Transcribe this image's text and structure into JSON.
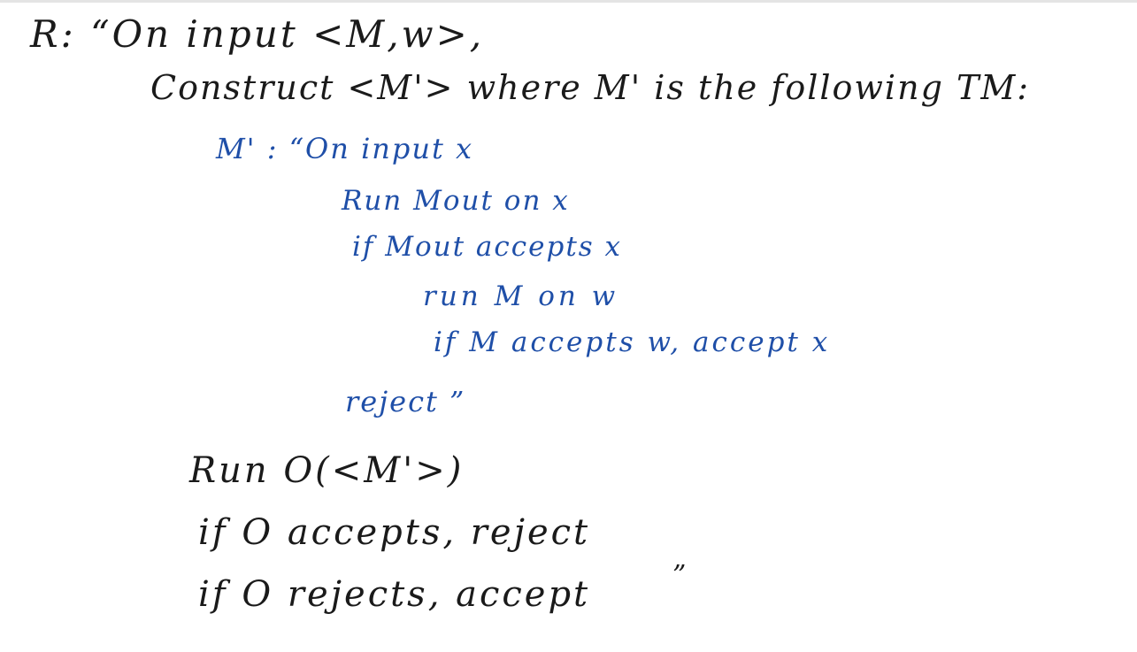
{
  "page": {
    "lines": [
      "R: “On input <M,w>,",
      "Construct <M'> where M' is the following TM:",
      "M' : “On input x",
      "Run Mout on x",
      "if Mout accepts x",
      "run M on w",
      "if M accepts w, accept x",
      "reject ”",
      "Run O(<M'>)",
      "if O accepts, reject",
      "if O rejects, accept",
      "”"
    ],
    "ink_colors": {
      "black": "#1a1a1a",
      "blue": "#1f4fa8"
    }
  }
}
